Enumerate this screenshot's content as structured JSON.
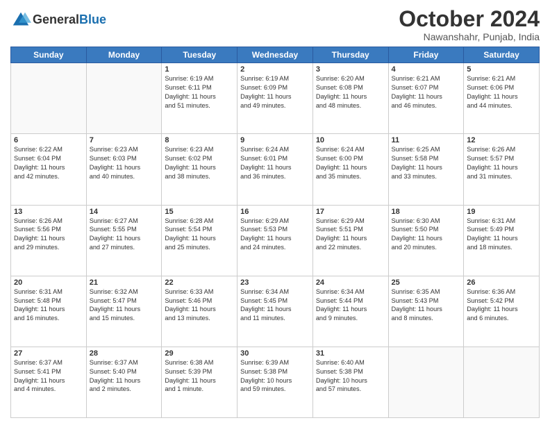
{
  "header": {
    "logo_line1": "General",
    "logo_line2": "Blue",
    "title": "October 2024",
    "subtitle": "Nawanshahr, Punjab, India"
  },
  "days_of_week": [
    "Sunday",
    "Monday",
    "Tuesday",
    "Wednesday",
    "Thursday",
    "Friday",
    "Saturday"
  ],
  "weeks": [
    [
      {
        "day": "",
        "info": ""
      },
      {
        "day": "",
        "info": ""
      },
      {
        "day": "1",
        "info": "Sunrise: 6:19 AM\nSunset: 6:11 PM\nDaylight: 11 hours\nand 51 minutes."
      },
      {
        "day": "2",
        "info": "Sunrise: 6:19 AM\nSunset: 6:09 PM\nDaylight: 11 hours\nand 49 minutes."
      },
      {
        "day": "3",
        "info": "Sunrise: 6:20 AM\nSunset: 6:08 PM\nDaylight: 11 hours\nand 48 minutes."
      },
      {
        "day": "4",
        "info": "Sunrise: 6:21 AM\nSunset: 6:07 PM\nDaylight: 11 hours\nand 46 minutes."
      },
      {
        "day": "5",
        "info": "Sunrise: 6:21 AM\nSunset: 6:06 PM\nDaylight: 11 hours\nand 44 minutes."
      }
    ],
    [
      {
        "day": "6",
        "info": "Sunrise: 6:22 AM\nSunset: 6:04 PM\nDaylight: 11 hours\nand 42 minutes."
      },
      {
        "day": "7",
        "info": "Sunrise: 6:23 AM\nSunset: 6:03 PM\nDaylight: 11 hours\nand 40 minutes."
      },
      {
        "day": "8",
        "info": "Sunrise: 6:23 AM\nSunset: 6:02 PM\nDaylight: 11 hours\nand 38 minutes."
      },
      {
        "day": "9",
        "info": "Sunrise: 6:24 AM\nSunset: 6:01 PM\nDaylight: 11 hours\nand 36 minutes."
      },
      {
        "day": "10",
        "info": "Sunrise: 6:24 AM\nSunset: 6:00 PM\nDaylight: 11 hours\nand 35 minutes."
      },
      {
        "day": "11",
        "info": "Sunrise: 6:25 AM\nSunset: 5:58 PM\nDaylight: 11 hours\nand 33 minutes."
      },
      {
        "day": "12",
        "info": "Sunrise: 6:26 AM\nSunset: 5:57 PM\nDaylight: 11 hours\nand 31 minutes."
      }
    ],
    [
      {
        "day": "13",
        "info": "Sunrise: 6:26 AM\nSunset: 5:56 PM\nDaylight: 11 hours\nand 29 minutes."
      },
      {
        "day": "14",
        "info": "Sunrise: 6:27 AM\nSunset: 5:55 PM\nDaylight: 11 hours\nand 27 minutes."
      },
      {
        "day": "15",
        "info": "Sunrise: 6:28 AM\nSunset: 5:54 PM\nDaylight: 11 hours\nand 25 minutes."
      },
      {
        "day": "16",
        "info": "Sunrise: 6:29 AM\nSunset: 5:53 PM\nDaylight: 11 hours\nand 24 minutes."
      },
      {
        "day": "17",
        "info": "Sunrise: 6:29 AM\nSunset: 5:51 PM\nDaylight: 11 hours\nand 22 minutes."
      },
      {
        "day": "18",
        "info": "Sunrise: 6:30 AM\nSunset: 5:50 PM\nDaylight: 11 hours\nand 20 minutes."
      },
      {
        "day": "19",
        "info": "Sunrise: 6:31 AM\nSunset: 5:49 PM\nDaylight: 11 hours\nand 18 minutes."
      }
    ],
    [
      {
        "day": "20",
        "info": "Sunrise: 6:31 AM\nSunset: 5:48 PM\nDaylight: 11 hours\nand 16 minutes."
      },
      {
        "day": "21",
        "info": "Sunrise: 6:32 AM\nSunset: 5:47 PM\nDaylight: 11 hours\nand 15 minutes."
      },
      {
        "day": "22",
        "info": "Sunrise: 6:33 AM\nSunset: 5:46 PM\nDaylight: 11 hours\nand 13 minutes."
      },
      {
        "day": "23",
        "info": "Sunrise: 6:34 AM\nSunset: 5:45 PM\nDaylight: 11 hours\nand 11 minutes."
      },
      {
        "day": "24",
        "info": "Sunrise: 6:34 AM\nSunset: 5:44 PM\nDaylight: 11 hours\nand 9 minutes."
      },
      {
        "day": "25",
        "info": "Sunrise: 6:35 AM\nSunset: 5:43 PM\nDaylight: 11 hours\nand 8 minutes."
      },
      {
        "day": "26",
        "info": "Sunrise: 6:36 AM\nSunset: 5:42 PM\nDaylight: 11 hours\nand 6 minutes."
      }
    ],
    [
      {
        "day": "27",
        "info": "Sunrise: 6:37 AM\nSunset: 5:41 PM\nDaylight: 11 hours\nand 4 minutes."
      },
      {
        "day": "28",
        "info": "Sunrise: 6:37 AM\nSunset: 5:40 PM\nDaylight: 11 hours\nand 2 minutes."
      },
      {
        "day": "29",
        "info": "Sunrise: 6:38 AM\nSunset: 5:39 PM\nDaylight: 11 hours\nand 1 minute."
      },
      {
        "day": "30",
        "info": "Sunrise: 6:39 AM\nSunset: 5:38 PM\nDaylight: 10 hours\nand 59 minutes."
      },
      {
        "day": "31",
        "info": "Sunrise: 6:40 AM\nSunset: 5:38 PM\nDaylight: 10 hours\nand 57 minutes."
      },
      {
        "day": "",
        "info": ""
      },
      {
        "day": "",
        "info": ""
      }
    ]
  ]
}
